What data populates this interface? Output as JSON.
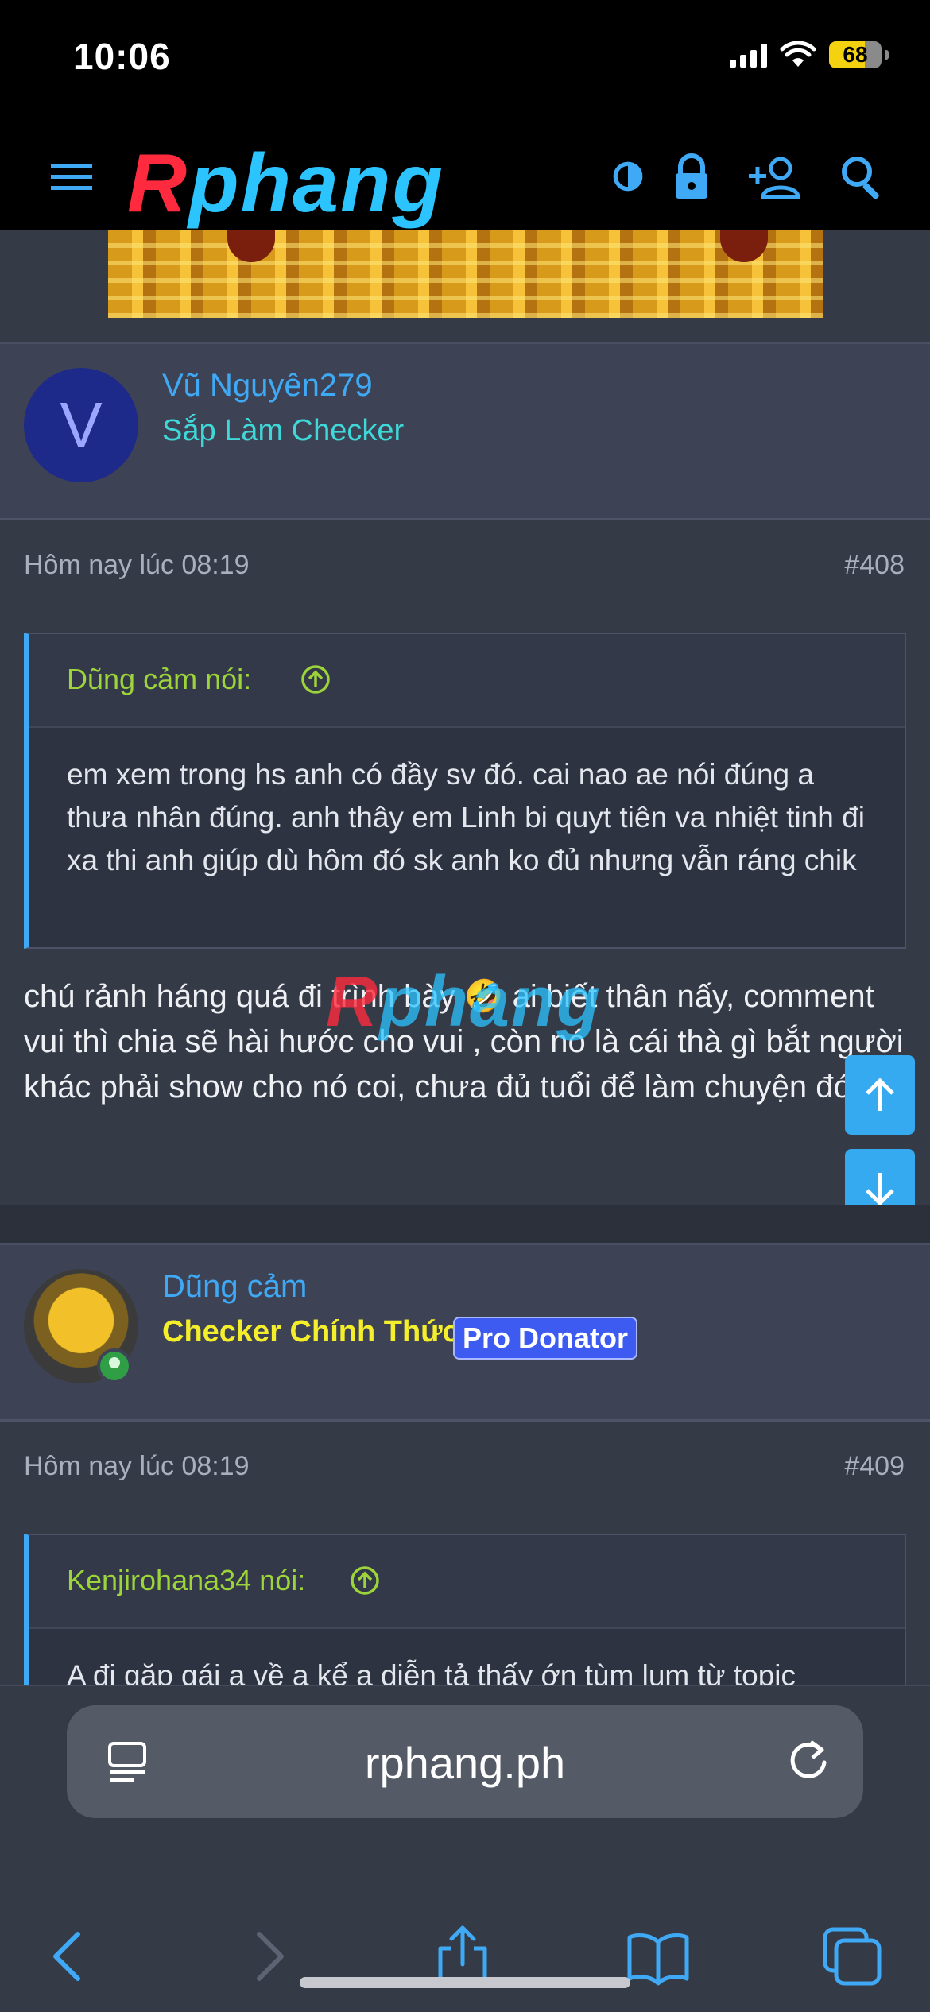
{
  "status_bar": {
    "time": "10:06",
    "battery": "68",
    "battery_level": 0.68
  },
  "header": {
    "logo_first": "R",
    "logo_rest": "phang",
    "icons": [
      "menu-icon",
      "theme-toggle-icon",
      "lock-icon",
      "add-user-icon",
      "search-icon"
    ]
  },
  "posts": [
    {
      "username": "Vũ Nguyên279",
      "user_title": "Sắp Làm Checker",
      "avatar_letter": "V",
      "timestamp": "Hôm nay lúc 08:19",
      "post_number": "#408",
      "quote": {
        "author": "Dũng cảm nói:",
        "text": "em xem trong hs anh có đầy sv đó. cai nao ae nói đúng a thưa nhân đúng. anh thây em Linh bi quyt tiên va nhiệt tinh đi xa thi anh giúp dù hôm đó sk anh ko đủ nhưng vẫn ráng chik"
      },
      "text": "chú rảnh háng quá đi trình bày 🤣 ai biết thân nấy, comment vui thì chia sẽ hài hước cho vui , còn nó là cái thà gì bắt người khác phải show cho nó coi, chưa đủ tuổi để làm chuyện đó."
    },
    {
      "username": "Dũng cảm",
      "user_title": "Checker Chính Thức",
      "badge": "Pro Donator",
      "timestamp": "Hôm nay lúc 08:19",
      "post_number": "#409",
      "quote": {
        "author": "Kenjirohana34 nói:",
        "text": "A đi gặp gái a về a kể a diễn tả thấy ớn tùm lum từ topic"
      }
    }
  ],
  "watermark": {
    "first": "R",
    "rest": "phang"
  },
  "browser": {
    "url": "rphang.ph"
  },
  "colors": {
    "accent": "#3fa9f5",
    "quote_author": "#9cd43a",
    "rank_title": "#f5ee2a",
    "user_title": "#3fd8d8",
    "badge_bg": "#3d5bf0"
  }
}
